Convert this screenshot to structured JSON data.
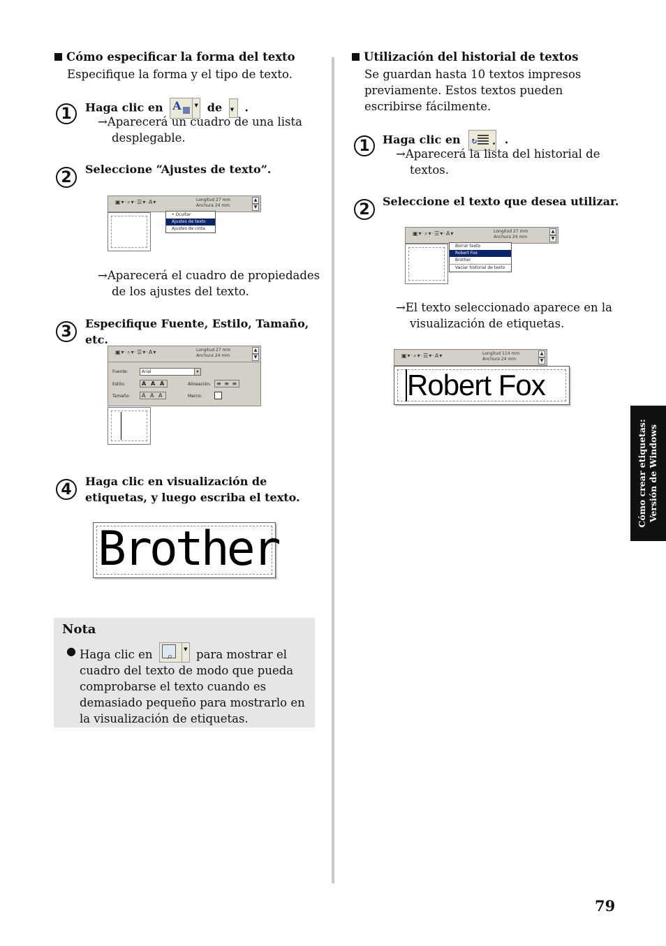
{
  "left": {
    "section_title": "Cómo especificar la forma del texto",
    "section_intro": "Especifique la forma y el tipo de texto.",
    "steps": [
      {
        "num": "1",
        "title_pre": "Haga clic en",
        "title_mid": "de",
        "title_end": ".",
        "result": "→Aparecerá un cuadro de una lista desplegable."
      },
      {
        "num": "2",
        "title": "Seleccione “Ajustes de texto”.",
        "result": "→Aparecerá el cuadro de propiedades de los ajustes del texto."
      },
      {
        "num": "3",
        "title": "Especifique Fuente, Estilo, Tamaño, etc."
      },
      {
        "num": "4",
        "title": "Haga clic en visualización de etiquetas, y luego escriba el texto."
      }
    ],
    "shot1": {
      "info_l1": "Longitud 27 mm",
      "info_l2": "Anchura 24 mm",
      "menu": [
        "Ocultar",
        "Ajustes de texto",
        "Ajustes de cinta"
      ]
    },
    "shot2": {
      "info_l1": "Longitud 27 mm",
      "info_l2": "Anchura 24 mm",
      "fuente_label": "Fuente:",
      "fuente_value": "Arial",
      "estilo_label": "Estilo:",
      "tamano_label": "Tamaño:",
      "alineacion_label": "Alineación:",
      "marco_label": "Marco:"
    },
    "label_text": "Brother",
    "nota": {
      "title": "Nota",
      "text_pre": "Haga clic en",
      "text_post": "para mostrar el cuadro del texto de modo que pueda comprobarse el texto cuando es demasiado pequeño para mostrarlo en la visualización de etiquetas."
    }
  },
  "right": {
    "section_title": "Utilización del historial de textos",
    "section_intro": "Se guardan hasta 10 textos impresos previamente. Estos textos pueden escribirse fácilmente.",
    "steps": [
      {
        "num": "1",
        "title_pre": "Haga clic en",
        "title_end": ".",
        "result": "→Aparecerá la lista del historial de textos."
      },
      {
        "num": "2",
        "title": "Seleccione el texto que desea utilizar.",
        "result": "→El texto seleccionado aparece en la visualización de etiquetas."
      }
    ],
    "shot1": {
      "info_l1": "Longitud 27 mm",
      "info_l2": "Anchura 24 mm",
      "menu": [
        "Borrar texto",
        "Robert Fox",
        "Brother",
        "Vaciar historial de texto"
      ]
    },
    "shot2": {
      "info_l1": "Longitud 114 mm",
      "info_l2": "Anchura 24 mm"
    },
    "label_text": "Robert Fox"
  },
  "side_tab": {
    "line1": "Cómo crear etiquetas:",
    "line2": "Versión de Windows"
  },
  "page_number": "79"
}
